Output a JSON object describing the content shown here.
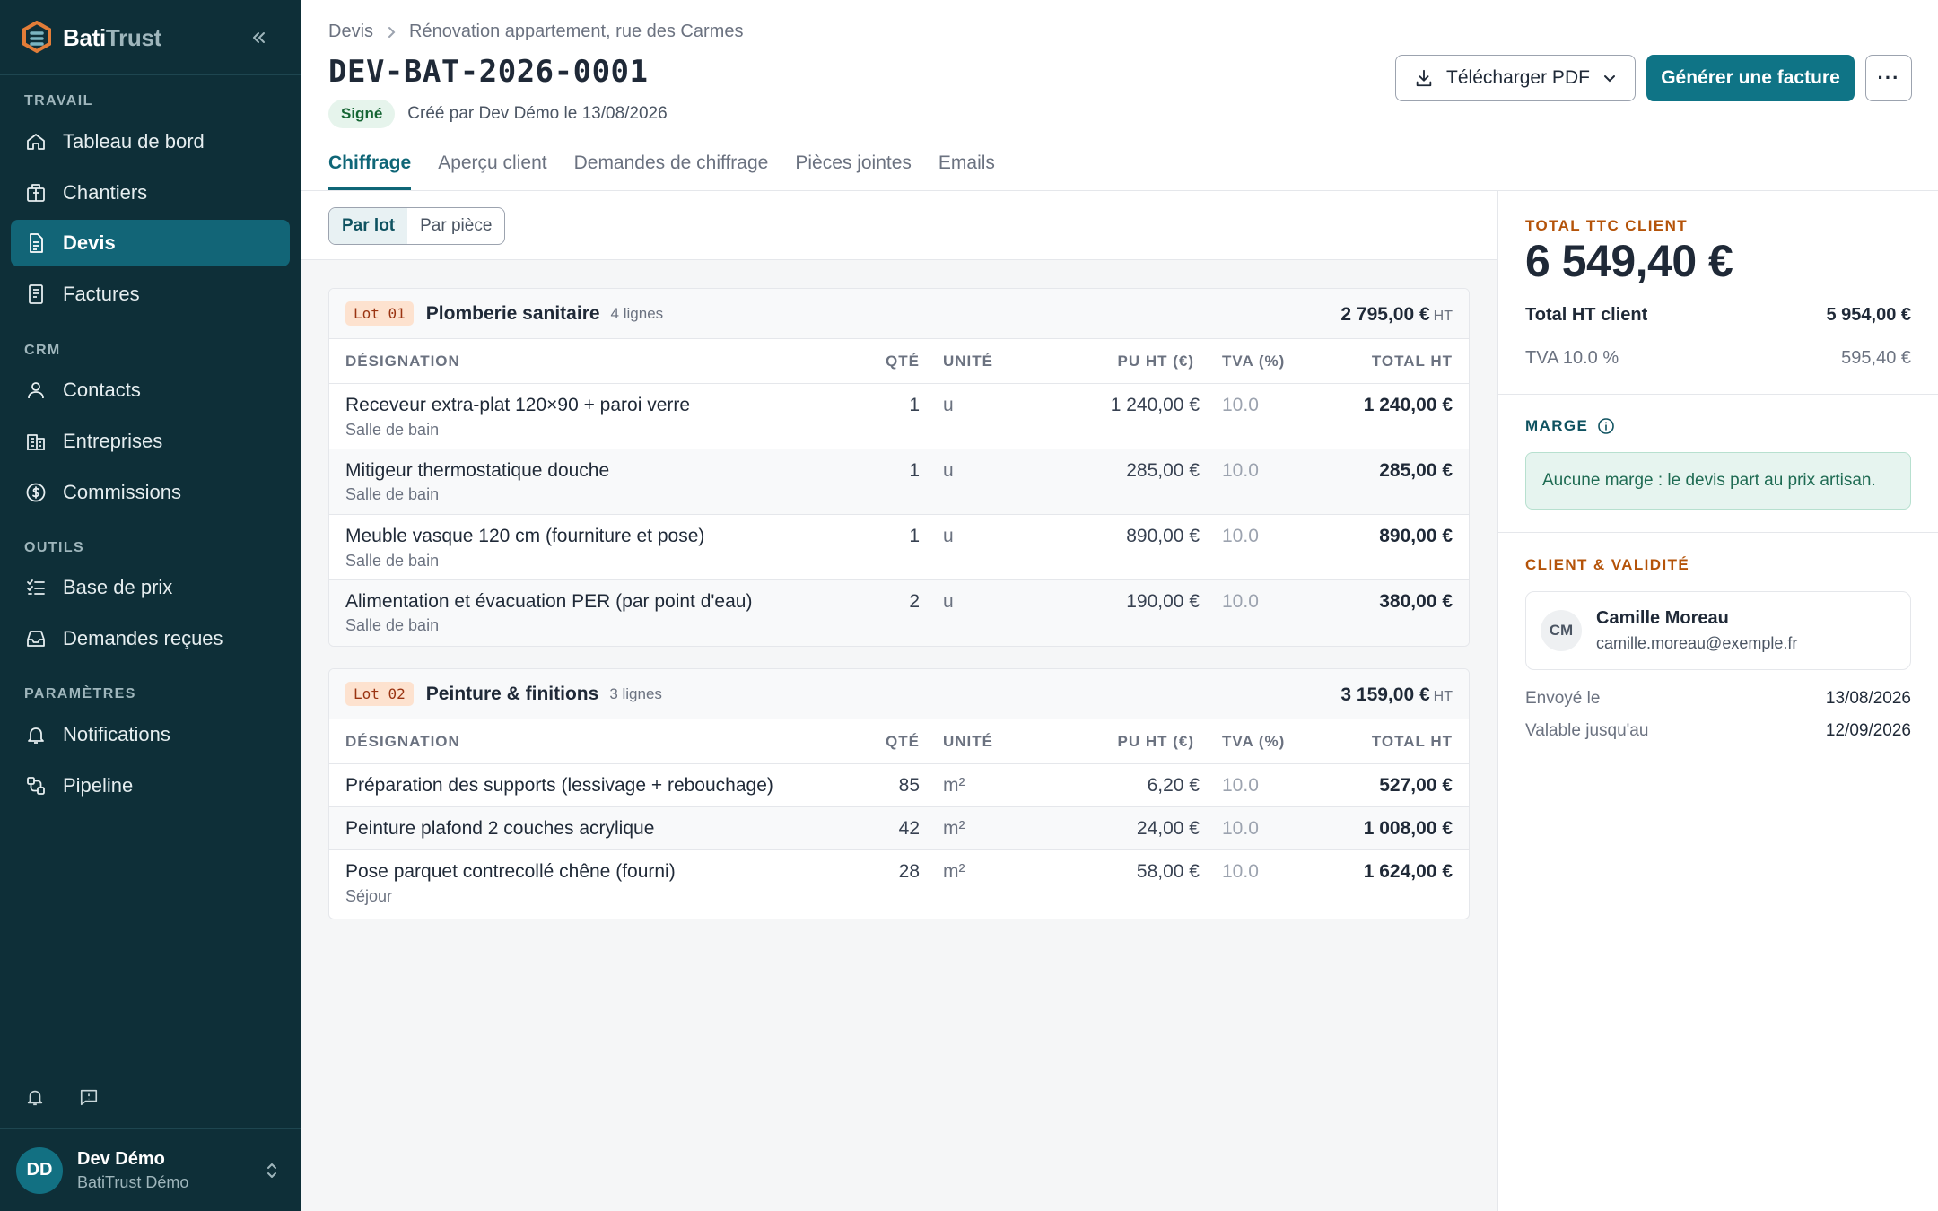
{
  "app": {
    "brand_main": "Bati",
    "brand_accent": "Trust"
  },
  "sidebar": {
    "sections": {
      "travail": "TRAVAIL",
      "crm": "CRM",
      "outils": "OUTILS",
      "parametres": "PARAMÈTRES"
    },
    "items": [
      {
        "label": "Tableau de bord",
        "icon": "home-icon"
      },
      {
        "label": "Chantiers",
        "icon": "building-icon"
      },
      {
        "label": "Devis",
        "icon": "document-icon"
      },
      {
        "label": "Factures",
        "icon": "invoice-icon"
      },
      {
        "label": "Contacts",
        "icon": "user-icon"
      },
      {
        "label": "Entreprises",
        "icon": "company-icon"
      },
      {
        "label": "Commissions",
        "icon": "dollar-circle-icon"
      },
      {
        "label": "Base de prix",
        "icon": "list-check-icon"
      },
      {
        "label": "Demandes reçues",
        "icon": "inbox-icon"
      },
      {
        "label": "Notifications",
        "icon": "bell-icon"
      },
      {
        "label": "Pipeline",
        "icon": "pipeline-icon"
      }
    ],
    "active_item": "Devis",
    "user": {
      "initials": "DD",
      "name": "Dev Démo",
      "org": "BatiTrust Démo"
    }
  },
  "header": {
    "breadcrumb": {
      "root": "Devis",
      "current": "Rénovation appartement, rue des Carmes"
    },
    "title": "DEV-BAT-2026-0001",
    "status": "Signé",
    "created_by": "Créé par Dev Démo le 13/08/2026",
    "buttons": {
      "pdf": "Télécharger PDF",
      "invoice": "Générer une facture",
      "more": "···"
    }
  },
  "tabs": [
    "Chiffrage",
    "Aperçu client",
    "Demandes de chiffrage",
    "Pièces jointes",
    "Emails"
  ],
  "active_tab": "Chiffrage",
  "view_toggle": {
    "by_lot": "Par lot",
    "by_room": "Par pièce",
    "selected": "Par lot"
  },
  "table_headers": {
    "designation": "DÉSIGNATION",
    "qte": "QTÉ",
    "unite": "UNITÉ",
    "pu": "PU HT (€)",
    "tva": "TVA (%)",
    "total": "TOTAL HT"
  },
  "lots": [
    {
      "tag": "Lot 01",
      "name": "Plomberie sanitaire",
      "lines_count": "4 lignes",
      "total": "2 795,00 €",
      "total_suffix": "HT",
      "rows": [
        {
          "designation": "Receveur extra-plat 120×90 + paroi verre",
          "room": "Salle de bain",
          "qte": "1",
          "unite": "u",
          "pu": "1 240,00 €",
          "tva": "10.0",
          "total": "1 240,00 €"
        },
        {
          "designation": "Mitigeur thermostatique douche",
          "room": "Salle de bain",
          "qte": "1",
          "unite": "u",
          "pu": "285,00 €",
          "tva": "10.0",
          "total": "285,00 €"
        },
        {
          "designation": "Meuble vasque 120 cm (fourniture et pose)",
          "room": "Salle de bain",
          "qte": "1",
          "unite": "u",
          "pu": "890,00 €",
          "tva": "10.0",
          "total": "890,00 €"
        },
        {
          "designation": "Alimentation et évacuation PER (par point d'eau)",
          "room": "Salle de bain",
          "qte": "2",
          "unite": "u",
          "pu": "190,00 €",
          "tva": "10.0",
          "total": "380,00 €"
        }
      ]
    },
    {
      "tag": "Lot 02",
      "name": "Peinture & finitions",
      "lines_count": "3 lignes",
      "total": "3 159,00 €",
      "total_suffix": "HT",
      "rows": [
        {
          "designation": "Préparation des supports (lessivage + rebouchage)",
          "room": "",
          "qte": "85",
          "unite": "m²",
          "pu": "6,20 €",
          "tva": "10.0",
          "total": "527,00 €"
        },
        {
          "designation": "Peinture plafond 2 couches acrylique",
          "room": "",
          "qte": "42",
          "unite": "m²",
          "pu": "24,00 €",
          "tva": "10.0",
          "total": "1 008,00 €"
        },
        {
          "designation": "Pose parquet contrecollé chêne (fourni)",
          "room": "Séjour",
          "qte": "28",
          "unite": "m²",
          "pu": "58,00 €",
          "tva": "10.0",
          "total": "1 624,00 €"
        }
      ]
    }
  ],
  "summary": {
    "ttc_label": "TOTAL TTC CLIENT",
    "ttc_value": "6 549,40 €",
    "ht_label": "Total HT client",
    "ht_value": "5 954,00 €",
    "tva_label": "TVA 10.0 %",
    "tva_value": "595,40 €",
    "marge_label": "MARGE",
    "marge_text": "Aucune marge : le devis part au prix artisan.",
    "client_label": "CLIENT & VALIDITÉ",
    "client": {
      "initials": "CM",
      "name": "Camille Moreau",
      "email": "camille.moreau@exemple.fr"
    },
    "sent_label": "Envoyé le",
    "sent_value": "13/08/2026",
    "valid_label": "Valable jusqu'au",
    "valid_value": "12/09/2026"
  },
  "colors": {
    "sidebar_bg": "#0e2f38",
    "accent": "#0f7486",
    "active_item": "#126577",
    "status_green": "#166534",
    "orange_label": "#b45309"
  }
}
